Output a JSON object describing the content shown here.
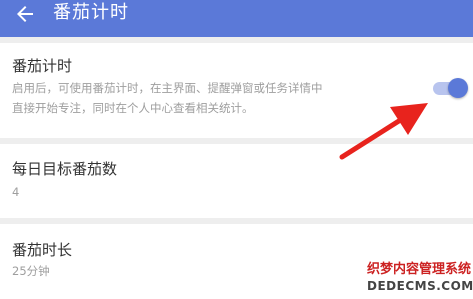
{
  "header": {
    "title": "番茄计时",
    "back_icon": "arrow-left-icon",
    "background": "#5b79d8"
  },
  "settings": {
    "pomodoro_timer": {
      "label": "番茄计时",
      "description_line1": "启用后，可使用番茄计时，在主界面、提醒弹窗或任务详情中",
      "description_line2": "直接开始专注，同时在个人中心查看相关统计。",
      "enabled": true
    },
    "daily_goal": {
      "label": "每日目标番茄数",
      "value": "4"
    },
    "pomodoro_duration": {
      "label": "番茄时长",
      "value": "25分钟"
    }
  },
  "annotation": {
    "icon": "red-arrow-icon",
    "color": "#e8231d"
  },
  "watermark": {
    "line1": "织梦内容管理系统",
    "line2": "DEDECMS.COM"
  }
}
